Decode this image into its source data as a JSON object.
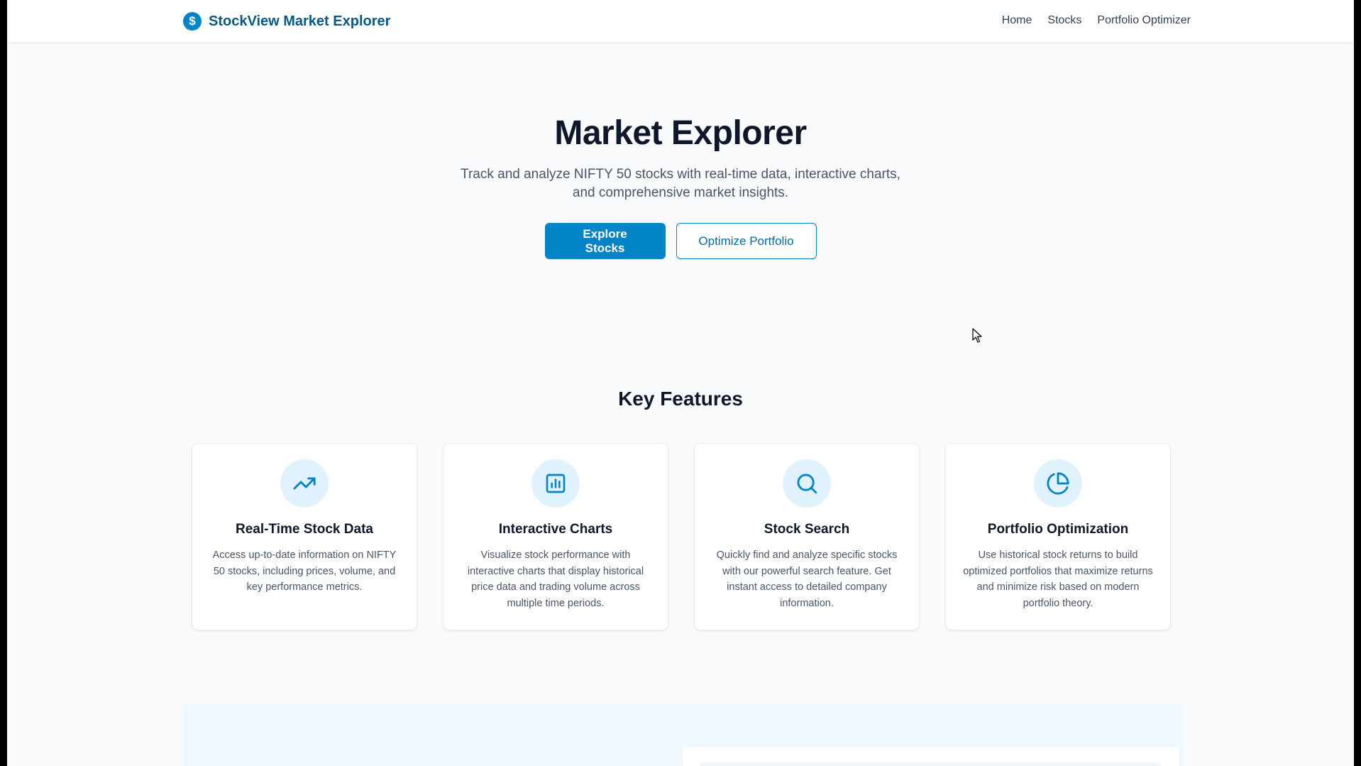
{
  "header": {
    "brand_logo_glyph": "$",
    "brand_name": "StockView Market Explorer",
    "nav": [
      {
        "label": "Home"
      },
      {
        "label": "Stocks"
      },
      {
        "label": "Portfolio Optimizer"
      }
    ]
  },
  "hero": {
    "title": "Market Explorer",
    "subtitle": "Track and analyze NIFTY 50 stocks with real-time data, interactive charts, and comprehensive market insights.",
    "primary_button": "Explore Stocks",
    "secondary_button": "Optimize Portfolio"
  },
  "features": {
    "title": "Key Features",
    "cards": [
      {
        "icon": "trending-up-icon",
        "title": "Real-Time Stock Data",
        "description": "Access up-to-date information on NIFTY 50 stocks, including prices, volume, and key performance metrics."
      },
      {
        "icon": "bar-chart-icon",
        "title": "Interactive Charts",
        "description": "Visualize stock performance with interactive charts that display historical price data and trading volume across multiple time periods."
      },
      {
        "icon": "search-icon",
        "title": "Stock Search",
        "description": "Quickly find and analyze specific stocks with our powerful search feature. Get instant access to detailed company information."
      },
      {
        "icon": "pie-chart-icon",
        "title": "Portfolio Optimization",
        "description": "Use historical stock returns to build optimized portfolios that maximize returns and minimize risk based on modern portfolio theory."
      }
    ]
  },
  "colors": {
    "accent": "#0284c7",
    "brand_text": "#075985",
    "icon_bg": "#e0f2fe",
    "page_bg": "#f9fafb"
  }
}
